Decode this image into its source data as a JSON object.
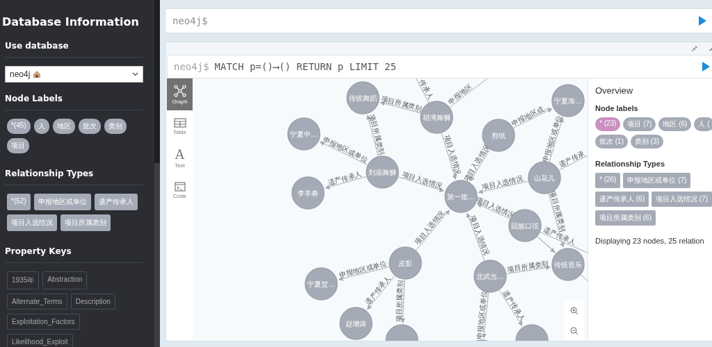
{
  "sidebar": {
    "title": "Database Information",
    "use_database": {
      "heading": "Use database",
      "value": "neo4j"
    },
    "node_labels": {
      "heading": "Node Labels",
      "items": [
        "*(45)",
        "人",
        "地区",
        "批次",
        "类别",
        "项目"
      ]
    },
    "relationship_types": {
      "heading": "Relationship Types",
      "items": [
        "*(52)",
        "申报地区或单位",
        "遗产传承人",
        "项目入选情况",
        "项目所属类别"
      ]
    },
    "property_keys": {
      "heading": "Property Keys",
      "items": [
        "1935年",
        "Abstraction",
        "Alternate_Terms",
        "Description",
        "Exploitation_Factors",
        "Likelihood_Exploit"
      ]
    }
  },
  "editor": {
    "prompt": "neo4j$"
  },
  "frame": {
    "prompt": "neo4j$",
    "query": "MATCH p=()⟶() RETURN p LIMIT 25",
    "views": [
      {
        "kind": "graph",
        "label": "Graph",
        "selected": true
      },
      {
        "kind": "table",
        "label": "Table",
        "selected": false
      },
      {
        "kind": "text",
        "glyph": "A",
        "label": "Text",
        "selected": false
      },
      {
        "kind": "code",
        "label": "Code",
        "selected": false
      }
    ],
    "graph": {
      "nodes": [
        {
          "kind": "labeled",
          "label": "传统舞蹈"
        },
        {
          "kind": "labeled",
          "label": "胡湾舞狮"
        },
        {
          "kind": "labeled",
          "label": "宁夏中…"
        },
        {
          "kind": "labeled",
          "label": "刘庙舞狮"
        },
        {
          "kind": "labeled",
          "label": "李丰春"
        },
        {
          "kind": "labeled",
          "label": "第一批…"
        },
        {
          "kind": "labeled",
          "label": "剪纸"
        },
        {
          "kind": "labeled",
          "label": "宁夏海…"
        },
        {
          "kind": "labeled",
          "label": "山花儿"
        },
        {
          "kind": "labeled",
          "label": "回族口弦"
        },
        {
          "kind": "labeled",
          "label": "传统音乐"
        },
        {
          "kind": "labeled",
          "label": "北武当…"
        },
        {
          "kind": "labeled",
          "label": "皮影"
        },
        {
          "kind": "labeled",
          "label": "宁夏贺…"
        },
        {
          "kind": "labeled",
          "label": "赵增涛"
        },
        {
          "kind": "unlabeled"
        },
        {
          "kind": "unlabeled"
        },
        {
          "kind": "unlabeled"
        }
      ],
      "relationships": [
        {
          "kind": "labeled",
          "label": "项目所属类别"
        },
        {
          "kind": "labeled",
          "label": "项目所属类别"
        },
        {
          "kind": "labeled",
          "label": "申报地区或单位"
        },
        {
          "kind": "labeled",
          "label": "遗产传承人"
        },
        {
          "kind": "labeled",
          "label": "项目入选情况"
        },
        {
          "kind": "labeled",
          "label": "项目入选情况"
        },
        {
          "kind": "labeled",
          "label": "项目入选情况"
        },
        {
          "kind": "labeled",
          "label": "申报地区或…"
        },
        {
          "kind": "labeled",
          "label": "申报地区或单位"
        },
        {
          "kind": "labeled",
          "label": "项目入选情况"
        },
        {
          "kind": "labeled",
          "label": "遗产传承"
        },
        {
          "kind": "labeled",
          "label": "项目入选情况"
        },
        {
          "kind": "plain"
        },
        {
          "kind": "labeled",
          "label": "遗产传承人"
        },
        {
          "kind": "labeled",
          "label": "项目所属类别"
        },
        {
          "kind": "plain"
        },
        {
          "kind": "labeled",
          "label": "项目入选情况"
        },
        {
          "kind": "labeled",
          "label": "项目所属类别"
        },
        {
          "kind": "labeled",
          "label": "申报地区或单位"
        },
        {
          "kind": "labeled",
          "label": "遗产传承人"
        },
        {
          "kind": "labeled",
          "label": "项目入选情况"
        },
        {
          "kind": "labeled",
          "label": "申报地区或单位"
        },
        {
          "kind": "labeled",
          "label": "遗产传承人"
        },
        {
          "kind": "labeled",
          "label": "项目所属类别"
        },
        {
          "kind": "labeled",
          "label": "传承人"
        },
        {
          "kind": "labeled",
          "label": "申报地区"
        }
      ]
    },
    "overview": {
      "title": "Overview",
      "node_labels": {
        "heading": "Node labels",
        "items": [
          {
            "label": "* (23)",
            "color": "#c990c0"
          },
          {
            "label": "项目 (7)",
            "color": "#a5abb6"
          },
          {
            "label": "地区 (6)",
            "color": "#a5abb6"
          },
          {
            "label": "人 (",
            "color": "#a5abb6"
          },
          {
            "label": "批次 (1)",
            "color": "#a5abb6"
          },
          {
            "label": "类别 (3)",
            "color": "#a5abb6"
          }
        ]
      },
      "relationship_types": {
        "heading": "Relationship Types",
        "items": [
          "* (26)",
          "申报地区或单位 (7)",
          "遗产传承人 (6)",
          "项目入选情况 (7)",
          "项目所属类别 (6)"
        ]
      },
      "summary": "Displaying 23 nodes, 25 relation"
    }
  }
}
